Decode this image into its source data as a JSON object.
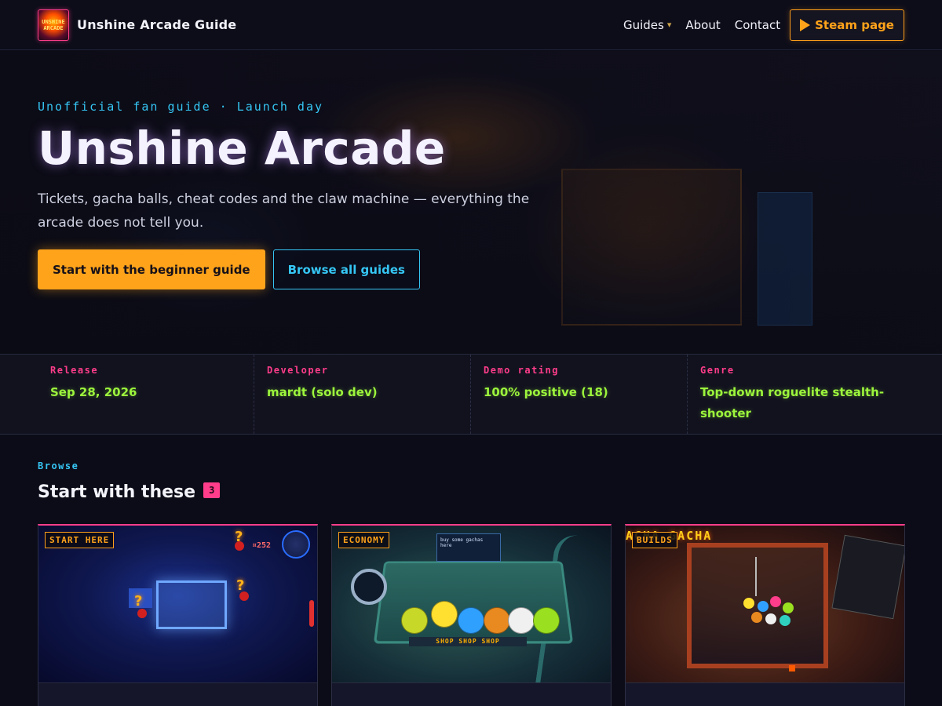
{
  "header": {
    "logo_text": "UNSHINE ARCADE",
    "site_title": "Unshine Arcade Guide",
    "nav": [
      {
        "label": "Guides",
        "icon": "chevron-down-icon"
      },
      {
        "label": "About"
      },
      {
        "label": "Contact"
      }
    ],
    "steam_button": {
      "label": "Steam page",
      "icon": "play-icon"
    }
  },
  "hero": {
    "eyebrow": "Unofficial fan guide · Launch day",
    "title": "Unshine Arcade",
    "description": "Tickets, gacha balls, cheat codes and the claw machine — everything the arcade does not tell you.",
    "primary_button": "Start with the beginner guide",
    "secondary_button": "Browse all guides"
  },
  "stats": [
    {
      "label": "Release",
      "value": "Sep 28, 2026"
    },
    {
      "label": "Developer",
      "value": "mardt (solo dev)"
    },
    {
      "label": "Demo rating",
      "value": "100% positive (18)"
    },
    {
      "label": "Genre",
      "value": "Top-down roguelite stealth-shooter"
    }
  ],
  "browse": {
    "eyebrow": "Browse",
    "title": "Start with these",
    "count": "3",
    "cards": [
      {
        "tag": "START HERE"
      },
      {
        "tag": "ECONOMY"
      },
      {
        "tag": "BUILDS"
      }
    ]
  },
  "colors": {
    "accent_pink": "#ff3d8a",
    "accent_orange": "#ffa31a",
    "accent_cyan": "#35c6f4",
    "accent_green": "#9cf53c",
    "background": "#0c0c18"
  }
}
